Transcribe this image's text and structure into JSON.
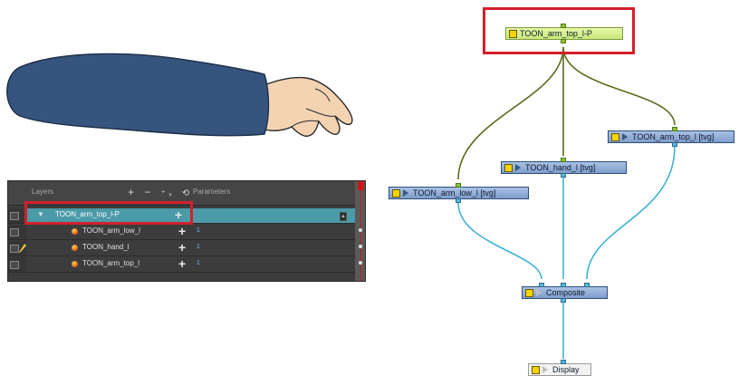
{
  "layers_panel": {
    "header_layers": "Layers",
    "header_parameters": "Parameters",
    "tools": [
      "+",
      "−",
      "⁺ₓ",
      "⟲"
    ],
    "rows": [
      {
        "name": "TOON_arm_top_l-P",
        "selected": true
      },
      {
        "name": "TOON_arm_low_l",
        "count": "1"
      },
      {
        "name": "TOON_hand_l",
        "count": "1"
      },
      {
        "name": "TOON_arm_top_l",
        "count": "1"
      }
    ],
    "expand_arrow": "▼",
    "scroll_arrow": "▲"
  },
  "nodes": {
    "peg": "TOON_arm_top_l-P",
    "arm_top": "TOON_arm_top_l [tvg]",
    "hand": "TOON_hand_l [tvg]",
    "arm_low": "TOON_arm_low_l [tvg]",
    "composite": "Composite",
    "display": "Display"
  },
  "colors": {
    "highlight_red": "#d2202c",
    "peg_wire": "#5b6b1c",
    "image_wire": "#3fb2d6",
    "node_blue": "#8fa9d6",
    "node_green": "#d6f08f",
    "sleeve": "#36557e",
    "skin": "#f1cfae"
  }
}
